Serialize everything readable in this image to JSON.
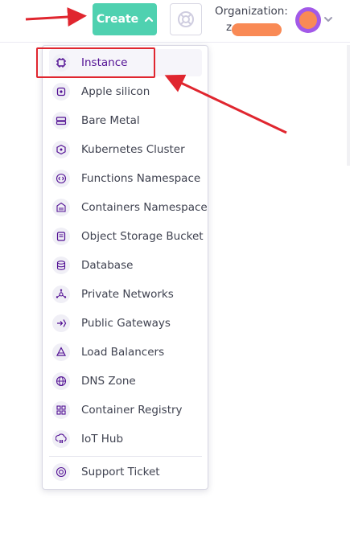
{
  "header": {
    "create_label": "Create",
    "organization_label": "Organization:",
    "organization_name_visible": "z"
  },
  "menu": {
    "items": [
      {
        "label": "Instance",
        "icon": "cpu-icon"
      },
      {
        "label": "Apple silicon",
        "icon": "apple-silicon-icon"
      },
      {
        "label": "Bare Metal",
        "icon": "server-icon"
      },
      {
        "label": "Kubernetes Cluster",
        "icon": "kubernetes-icon"
      },
      {
        "label": "Functions Namespace",
        "icon": "code-icon"
      },
      {
        "label": "Containers Namespace",
        "icon": "container-icon"
      },
      {
        "label": "Object Storage Bucket",
        "icon": "bucket-icon"
      },
      {
        "label": "Database",
        "icon": "database-icon"
      },
      {
        "label": "Private Networks",
        "icon": "network-icon"
      },
      {
        "label": "Public Gateways",
        "icon": "gateway-icon"
      },
      {
        "label": "Load Balancers",
        "icon": "load-balancer-icon"
      },
      {
        "label": "DNS Zone",
        "icon": "globe-icon"
      },
      {
        "label": "Container Registry",
        "icon": "registry-icon"
      },
      {
        "label": "IoT Hub",
        "icon": "iot-icon"
      }
    ],
    "support": {
      "label": "Support Ticket",
      "icon": "lifebuoy-icon"
    }
  },
  "colors": {
    "create_button": "#4fd1b0",
    "accent_purple": "#521094",
    "annotation_red": "#e0262f",
    "avatar": "#a259e8",
    "redaction": "#f98a55"
  }
}
